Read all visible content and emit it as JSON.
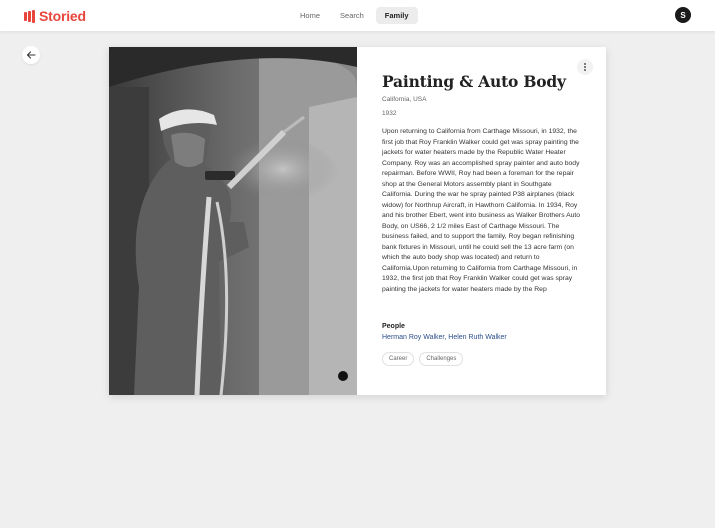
{
  "app": {
    "brand": "Storied"
  },
  "nav": {
    "items": [
      {
        "label": "Home",
        "active": false
      },
      {
        "label": "Search",
        "active": false
      },
      {
        "label": "Family",
        "active": true
      }
    ]
  },
  "user": {
    "avatar_initial": "S"
  },
  "icons": {
    "back": "arrow-left-icon",
    "more": "more-vertical-icon",
    "logo": "storied-logo-icon"
  },
  "colors": {
    "brand": "#e8453c",
    "link": "#2b4f8a"
  },
  "story": {
    "title": "Painting & Auto Body",
    "location": "California, USA",
    "year": "1932",
    "body": "Upon returning to California from Carthage Missouri, in 1932, the first job that Roy Franklin Walker could get was spray painting the jackets for water heaters made by the Republic Water Heater Company. Roy was an accomplished spray painter and auto body repairman. Before WWII, Roy had been a foreman for the repair shop at the General Motors assembly plant in Southgate California. During the war he spray painted P38 airplanes (black widow) for Northrup Aircraft, in Hawthorn California. In 1934, Roy and his brother Ebert, went into business as Walker Brothers Auto Body, on US66, 2 1/2 miles East of Carthage Missouri. The business failed, and to support the family, Roy began refinishing bank fixtures in Missouri, until he could sell the 13 acre farm (on which the auto body shop was located) and return to California.Upon returning to California from Carthage Missouri, in 1932, the first job that Roy Franklin Walker could get was spray painting the jackets for water heaters made by the Rep",
    "people_label": "People",
    "people": [
      "Herman Roy Walker",
      "Helen Ruth Walker"
    ],
    "people_separator": ", ",
    "tags": [
      "Career",
      "Challenges"
    ]
  }
}
